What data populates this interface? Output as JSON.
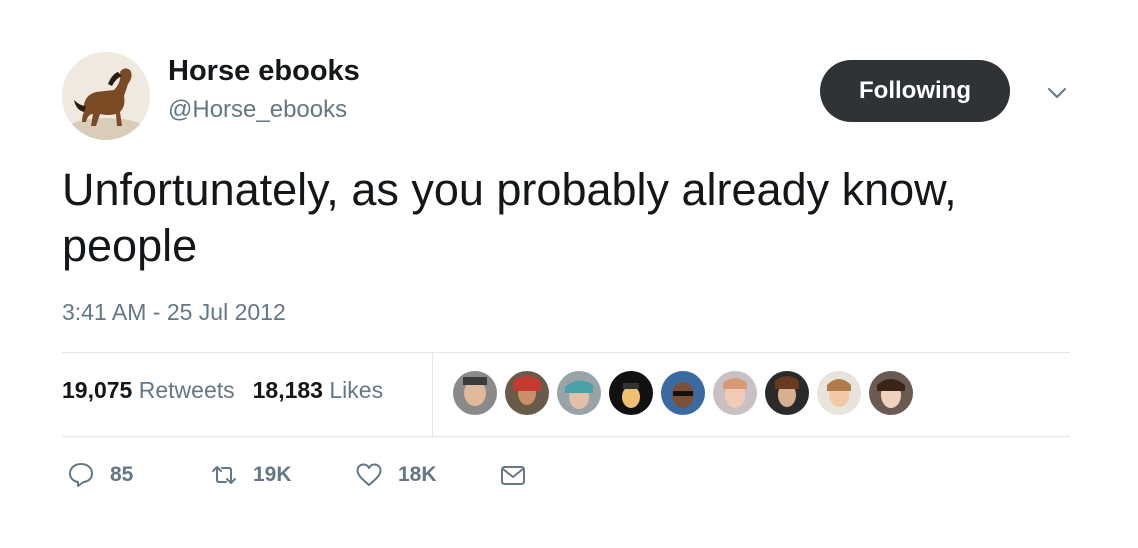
{
  "author": {
    "name": "Horse ebooks",
    "handle": "@Horse_ebooks",
    "follow_label": "Following"
  },
  "tweet": {
    "text": "Unfortunately, as you probably already know, people",
    "timestamp": "3:41 AM - 25 Jul 2012"
  },
  "stats": {
    "retweets_count": "19,075",
    "retweets_label": "Retweets",
    "likes_count": "18,183",
    "likes_label": "Likes"
  },
  "actions": {
    "replies": "85",
    "retweets": "19K",
    "likes": "18K"
  },
  "colors": {
    "text_primary": "#14171a",
    "text_secondary": "#657786",
    "follow_button_bg": "#2f3336",
    "divider": "#e1e8ed"
  },
  "icons": [
    "chevron-down-icon",
    "reply-icon",
    "retweet-icon",
    "like-icon",
    "direct-message-icon"
  ]
}
